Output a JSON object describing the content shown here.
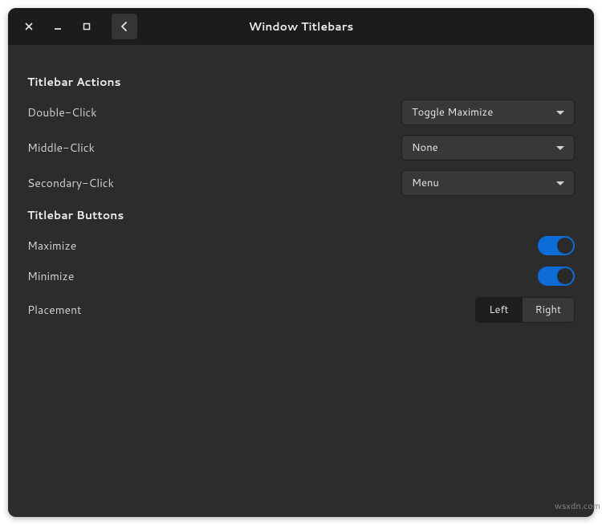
{
  "window": {
    "title": "Window Titlebars"
  },
  "sections": {
    "actions": {
      "title": "Titlebar Actions",
      "double_click": {
        "label": "Double-Click",
        "value": "Toggle Maximize"
      },
      "middle_click": {
        "label": "Middle-Click",
        "value": "None"
      },
      "secondary_click": {
        "label": "Secondary-Click",
        "value": "Menu"
      }
    },
    "buttons": {
      "title": "Titlebar Buttons",
      "maximize": {
        "label": "Maximize",
        "on": true
      },
      "minimize": {
        "label": "Minimize",
        "on": true
      },
      "placement": {
        "label": "Placement",
        "options": {
          "left": "Left",
          "right": "Right"
        },
        "selected": "left"
      }
    }
  },
  "watermark": "wsxdn.com"
}
